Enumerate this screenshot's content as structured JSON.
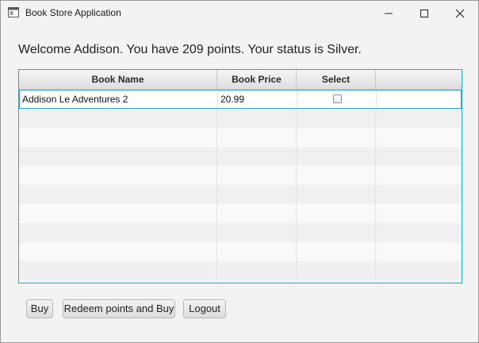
{
  "window": {
    "title": "Book Store Application",
    "icon": "app-window-icon",
    "controls": [
      "minimize-icon",
      "maximize-icon",
      "close-icon"
    ]
  },
  "welcome_text": "Welcome Addison. You have 209 points. Your status is Silver.",
  "table": {
    "columns": [
      "Book Name",
      "Book Price",
      "Select",
      ""
    ],
    "rows": [
      {
        "name": "Addison Le Adventures 2",
        "price": "20.99",
        "selected": false
      }
    ],
    "empty_rows": 9
  },
  "buttons": {
    "buy": "Buy",
    "redeem": "Redeem points and Buy",
    "logout": "Logout"
  },
  "colors": {
    "accent": "#27a5c9",
    "background": "#f3f3f3"
  }
}
